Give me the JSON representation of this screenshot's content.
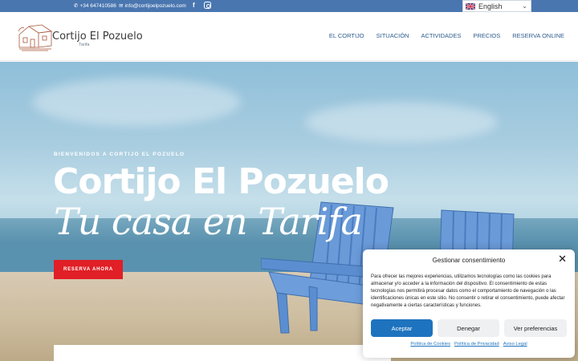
{
  "topbar": {
    "phone": "+34 647410586",
    "email": "info@cortijoelpozuelo.com",
    "icons": [
      "phone-icon",
      "mail-icon",
      "facebook-icon",
      "instagram-icon"
    ]
  },
  "language": {
    "selected": "English"
  },
  "header": {
    "brand": "Cortijo El Pozuelo",
    "brand_sub": "Tarifa",
    "nav": [
      "EL CORTIJO",
      "SITUACIÓN",
      "ACTIVIDADES",
      "PRECIOS",
      "RESERVA ONLINE"
    ]
  },
  "hero": {
    "welcome": "BIENVENIDOS A CORTIJO EL POZUELO",
    "title": "Cortijo El Pozuelo",
    "subtitle": "Tu casa en Tarifa",
    "cta": "RESERVA AHORA"
  },
  "consent": {
    "title": "Gestionar consentimiento",
    "text": "Para ofrecer las mejores experiencias, utilizamos tecnologías como las cookies para almacenar y/o acceder a la información del dispositivo. El consentimiento de estas tecnologías nos permitirá procesar datos como el comportamiento de navegación o las identificaciones únicas en este sitio. No consentir o retirar el consentimiento, puede afectar negativamente a ciertas características y funciones.",
    "accept": "Aceptar",
    "deny": "Denegar",
    "preferences": "Ver preferencias",
    "links": [
      "Política de Cookies",
      "Política de Privacidad",
      "Aviso Legal"
    ]
  },
  "colors": {
    "topbar": "#4a76b0",
    "nav_text": "#2c5c8e",
    "cta": "#e01f26",
    "accept": "#1e73be"
  }
}
